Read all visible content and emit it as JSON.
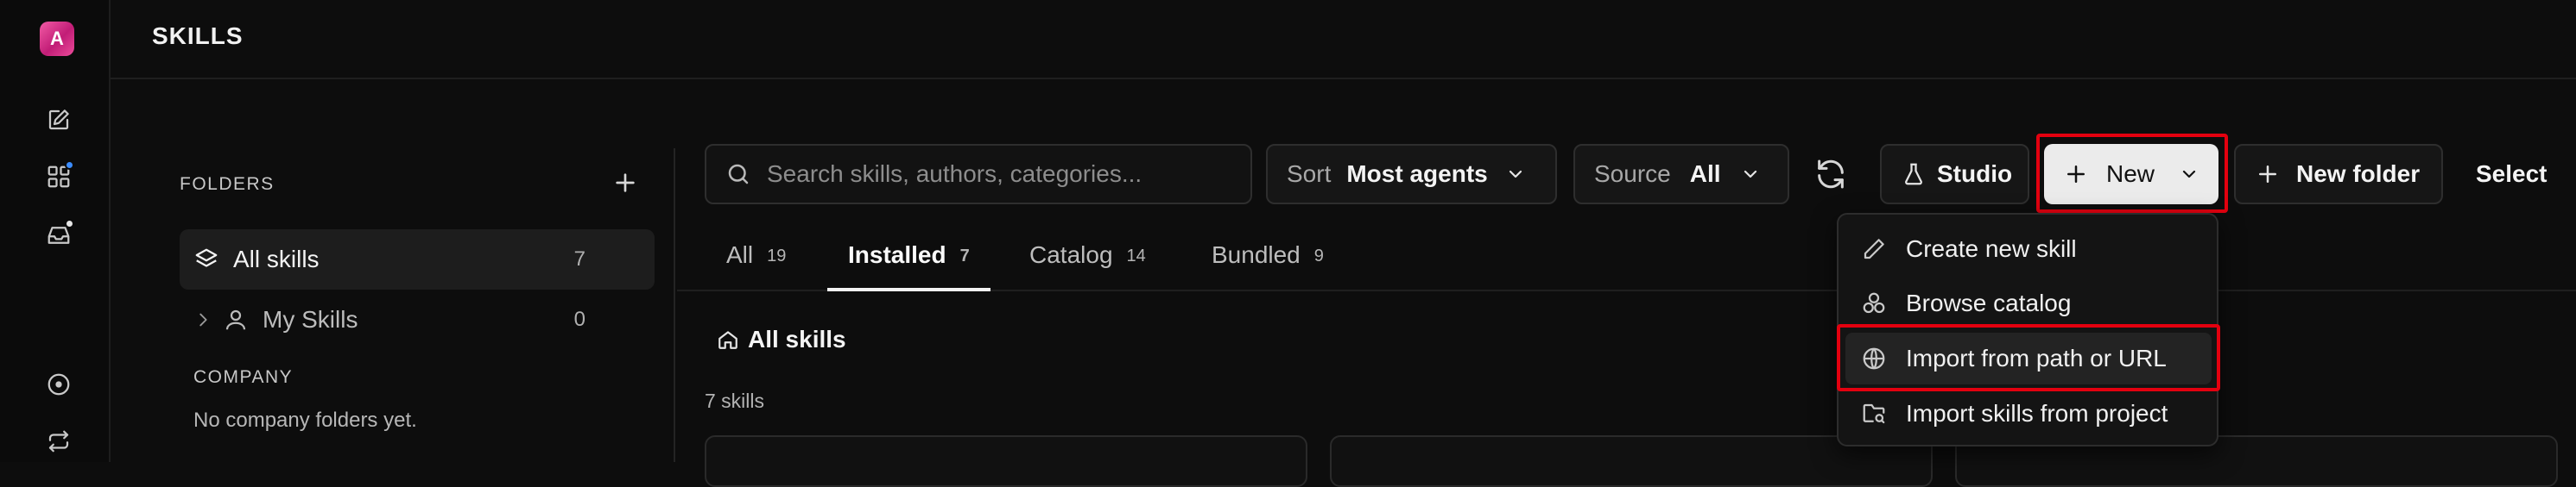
{
  "rail": {
    "avatar_letter": "A",
    "icons": [
      "compose-icon",
      "apps-icon",
      "inbox-icon",
      "circle-dot-icon",
      "swap-icon"
    ],
    "badge_colors": {
      "apps": "#3b8cff",
      "inbox": "#e6e6e6"
    }
  },
  "header": {
    "title": "SKILLS"
  },
  "folders": {
    "title": "FOLDERS",
    "items": [
      {
        "label": "All skills",
        "count": "7",
        "icon": "layers-icon"
      },
      {
        "label": "My Skills",
        "count": "0",
        "icon": "person-icon"
      }
    ],
    "company_title": "COMPANY",
    "company_empty": "No company folders yet."
  },
  "toolbar": {
    "search_placeholder": "Search skills, authors, categories...",
    "sort_label": "Sort",
    "sort_value": "Most agents",
    "source_label": "Source",
    "source_value": "All",
    "studio_label": "Studio",
    "new_label": "New",
    "new_folder_label": "New folder",
    "select_label": "Select"
  },
  "tabs": [
    {
      "label": "All",
      "count": "19"
    },
    {
      "label": "Installed",
      "count": "7",
      "active": true
    },
    {
      "label": "Catalog",
      "count": "14"
    },
    {
      "label": "Bundled",
      "count": "9"
    }
  ],
  "content": {
    "breadcrumb": "All skills",
    "skills_count": "7 skills"
  },
  "new_menu": {
    "items": [
      {
        "label": "Create new skill",
        "icon": "pencil-icon"
      },
      {
        "label": "Browse catalog",
        "icon": "cluster-icon"
      },
      {
        "label": "Import from path or URL",
        "icon": "globe-icon"
      },
      {
        "label": "Import skills from project",
        "icon": "folder-search-icon"
      }
    ]
  },
  "colors": {
    "background": "#0d0d0d",
    "highlight": "#e3000f",
    "new_button": "#ebebeb",
    "avatar": "#d6237f"
  }
}
